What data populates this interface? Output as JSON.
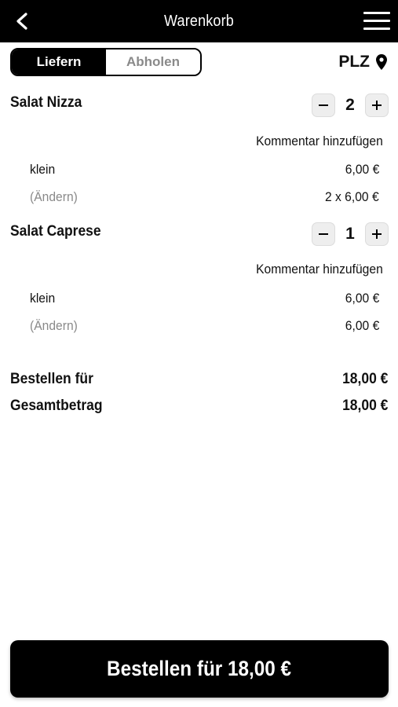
{
  "header": {
    "title": "Warenkorb",
    "back_icon": "chevron-left-icon",
    "menu_icon": "hamburger-menu-icon"
  },
  "delivery_toggle": {
    "options": [
      {
        "label": "Liefern",
        "selected": true
      },
      {
        "label": "Abholen",
        "selected": false
      }
    ]
  },
  "location": {
    "label": "PLZ",
    "icon": "map-pin-icon"
  },
  "cart": {
    "items": [
      {
        "name": "Salat Nizza",
        "quantity": "2",
        "comment_label": "Kommentar hinzufügen",
        "size": "klein",
        "size_price": "6,00 €",
        "change_label": "(Ändern)",
        "line_total": "2 x 6,00 €"
      },
      {
        "name": "Salat Caprese",
        "quantity": "1",
        "comment_label": "Kommentar hinzufügen",
        "size": "klein",
        "size_price": "6,00 €",
        "change_label": "(Ändern)",
        "line_total": "6,00 €"
      }
    ]
  },
  "summary": {
    "order_for_label": "Bestellen für",
    "order_for_value": "18,00 €",
    "total_label": "Gesamtbetrag",
    "total_value": "18,00 €"
  },
  "checkout": {
    "button_label": "Bestellen für 18,00 €"
  },
  "colors": {
    "header_bg": "#000000",
    "button_bg": "#000000",
    "muted_text": "#8a8a8a",
    "stepper_bg": "#eeeeee"
  }
}
